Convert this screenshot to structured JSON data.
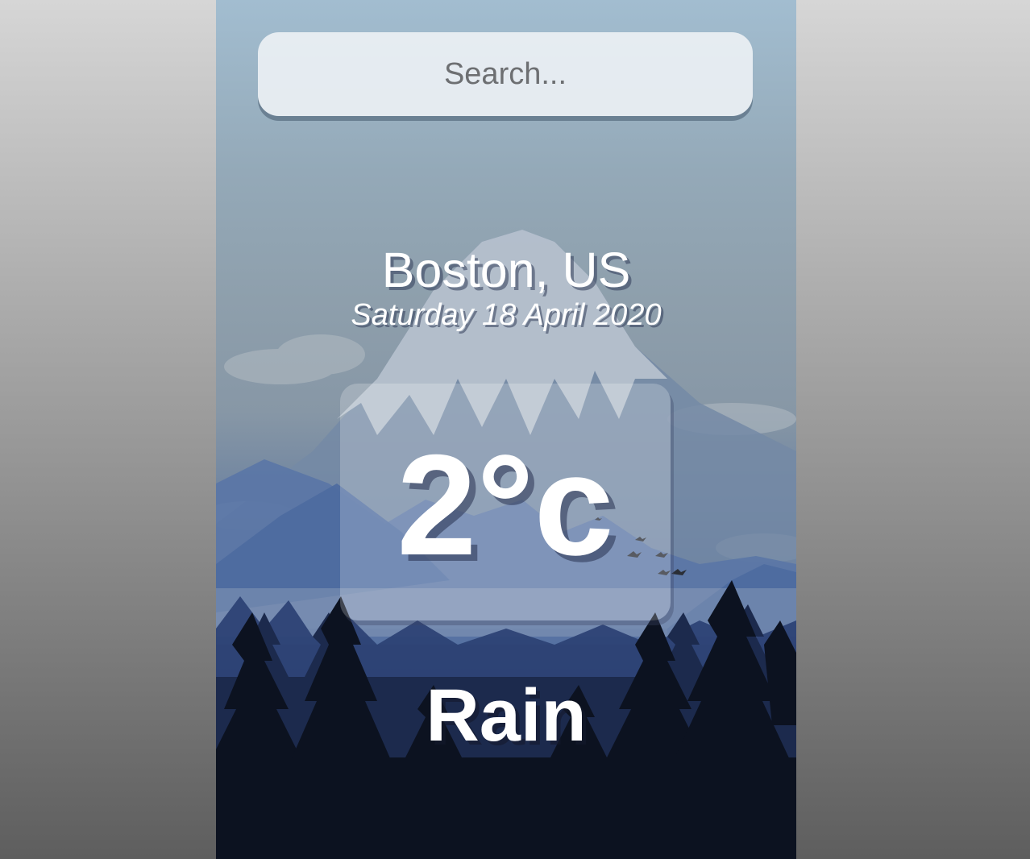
{
  "search": {
    "placeholder": "Search...",
    "value": ""
  },
  "location": {
    "city_country": "Boston, US",
    "date": "Saturday 18 April 2020"
  },
  "weather": {
    "temperature": "2°c",
    "condition": "Rain"
  },
  "colors": {
    "sky_top": "#a2bdd0",
    "mountain_snow": "#b7c4d1",
    "mountain_blue": "#5a78a8",
    "forest_dark": "#0f1626",
    "text": "#ffffff"
  }
}
